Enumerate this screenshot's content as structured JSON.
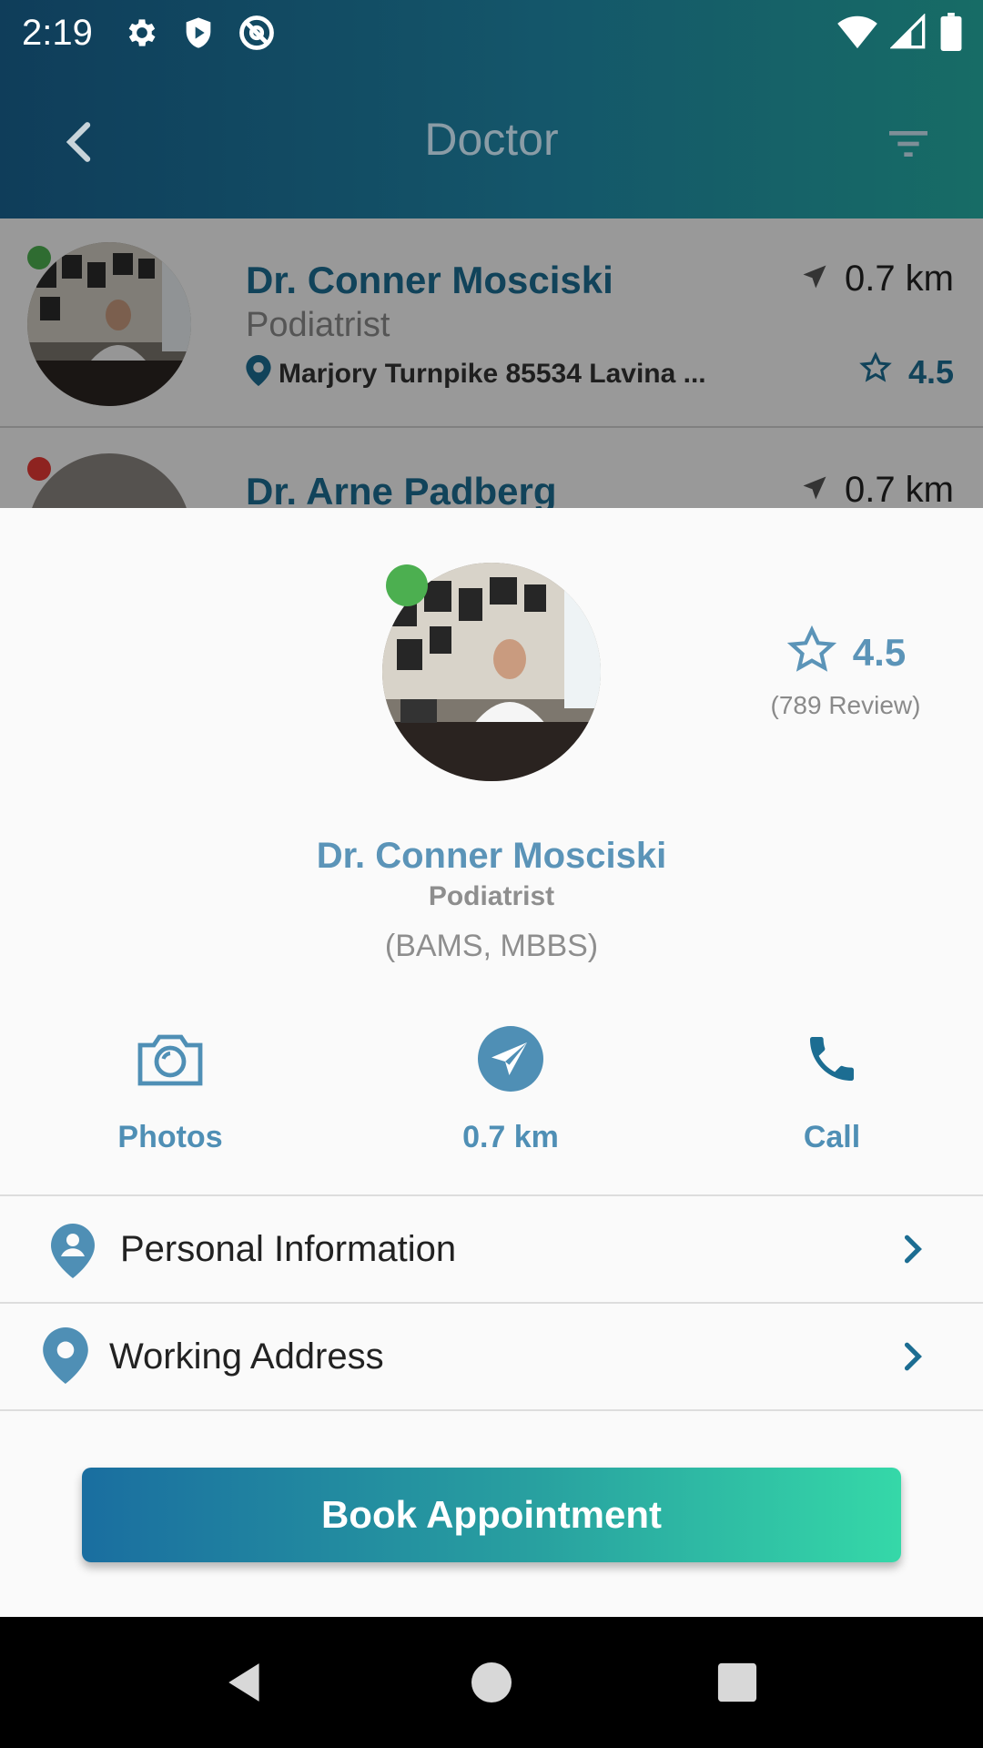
{
  "status_bar": {
    "time": "2:19",
    "icons": [
      "gear-icon",
      "shield-play-icon",
      "at-sign-off-icon",
      "wifi-icon",
      "cell-signal-icon",
      "battery-icon"
    ]
  },
  "app_bar": {
    "title": "Doctor",
    "back_icon": "chevron-left-icon",
    "filter_icon": "filter-icon"
  },
  "list": {
    "items": [
      {
        "name": "Dr. Conner Mosciski",
        "specialty": "Podiatrist",
        "address": "Marjory Turnpike 85534 Lavina ...",
        "distance": "0.7 km",
        "rating": "4.5",
        "status_color": "#4caf50"
      },
      {
        "name": "Dr. Arne Padberg",
        "distance": "0.7 km",
        "status_color": "#e53935"
      }
    ]
  },
  "profile": {
    "name": "Dr. Conner Mosciski",
    "specialty": "Podiatrist",
    "degrees": "(BAMS, MBBS)",
    "rating": "4.5",
    "reviews": "(789 Review)",
    "online_color": "#4caf50"
  },
  "actions": [
    {
      "label": "Photos",
      "icon": "camera-icon"
    },
    {
      "label": "0.7 km",
      "icon": "send-icon"
    },
    {
      "label": "Call",
      "icon": "phone-icon"
    }
  ],
  "menu": [
    {
      "label": "Personal Information",
      "icon": "person-pin-icon"
    },
    {
      "label": "Working Address",
      "icon": "location-pin-icon"
    }
  ],
  "book_button": {
    "label": "Book Appointment"
  },
  "colors": {
    "primary": "#1c6d92",
    "accent_light": "#5b94b8",
    "gradient_start": "#1a6ea0",
    "gradient_end": "#35d8a8"
  },
  "nav_bar": {
    "icons": [
      "back-triangle-icon",
      "home-circle-icon",
      "recents-square-icon"
    ]
  }
}
